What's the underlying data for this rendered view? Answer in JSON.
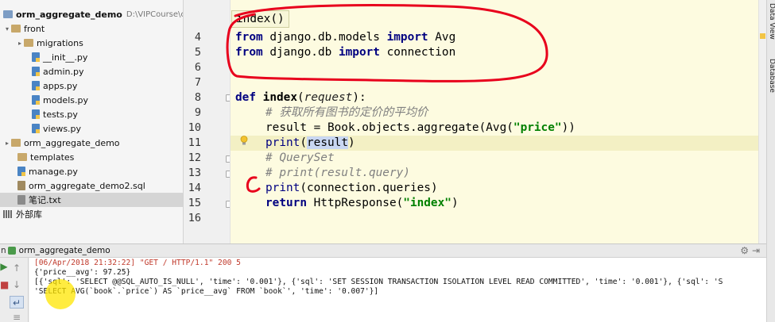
{
  "sidebar": {
    "project_name": "orm_aggregate_demo",
    "project_path": "D:\\VIPCourse\\cod",
    "items": [
      {
        "label": "front",
        "icon": "folder-icon",
        "arrow": "▾"
      },
      {
        "label": "migrations",
        "icon": "folder-icon",
        "arrow": "▸"
      },
      {
        "label": "__init__.py",
        "icon": "python-file-icon"
      },
      {
        "label": "admin.py",
        "icon": "python-file-icon"
      },
      {
        "label": "apps.py",
        "icon": "python-file-icon"
      },
      {
        "label": "models.py",
        "icon": "python-file-icon"
      },
      {
        "label": "tests.py",
        "icon": "python-file-icon"
      },
      {
        "label": "views.py",
        "icon": "python-file-icon"
      },
      {
        "label": "orm_aggregate_demo",
        "icon": "folder-icon",
        "arrow": "▸"
      },
      {
        "label": "templates",
        "icon": "folder-icon"
      },
      {
        "label": "manage.py",
        "icon": "python-file-icon"
      },
      {
        "label": "orm_aggregate_demo2.sql",
        "icon": "sql-file-icon"
      },
      {
        "label": "笔记.txt",
        "icon": "text-file-icon"
      },
      {
        "label": "外部库",
        "icon": "library-icon"
      }
    ]
  },
  "editor": {
    "breadcrumb": "index()",
    "line_numbers": [
      "4",
      "5",
      "6",
      "7",
      "8",
      "9",
      "10",
      "11",
      "12",
      "13",
      "14",
      "15",
      "16"
    ],
    "current_line": "11",
    "code": {
      "l4_kw1": "from",
      "l4_mod": " django.db.models ",
      "l4_kw2": "import",
      "l4_name": " Avg",
      "l5_kw1": "from",
      "l5_mod": " django.db ",
      "l5_kw2": "import",
      "l5_name": " connection",
      "l8_kw": "def",
      "l8_fn": "index",
      "l8_open": "(",
      "l8_param": "request",
      "l8_close": "):",
      "l9_comment": "# 获取所有图书的定价的平均价",
      "l10_a": "result = Book.objects.aggregate(Avg(",
      "l10_str": "\"price\"",
      "l10_b": "))",
      "l11_print": "print",
      "l11_open": "(",
      "l11_sel": "result",
      "l11_close": ")",
      "l12_comment": "# QuerySet",
      "l13_comment": "# print(result.query)",
      "l14_print": "print",
      "l14_rest": "(connection.queries)",
      "l15_kw": "return",
      "l15_a": " HttpResponse(",
      "l15_str": "\"index\"",
      "l15_b": ")"
    }
  },
  "right_tabs": {
    "data_view": "Data View",
    "database": "Database"
  },
  "run_panel": {
    "label_prefix": "n",
    "tab_title": "orm_aggregate_demo",
    "console_lines": [
      "[06/Apr/2018 21:32:22] \"GET / HTTP/1.1\" 200 5",
      "{'price__avg': 97.25}",
      "[{'sql': 'SELECT @@SQL_AUTO_IS_NULL', 'time': '0.001'}, {'sql': 'SET SESSION TRANSACTION ISOLATION LEVEL READ COMMITTED', 'time': '0.001'}, {'sql': 'S",
      "'SELECT AVG(`book`.`price`) AS `price__avg` FROM `book`', 'time': '0.007'}]"
    ]
  },
  "colors": {
    "editor_bg": "#fdfbe0",
    "keyword": "#000080",
    "string": "#008000",
    "comment": "#808080",
    "annotation": "#e8001c"
  }
}
